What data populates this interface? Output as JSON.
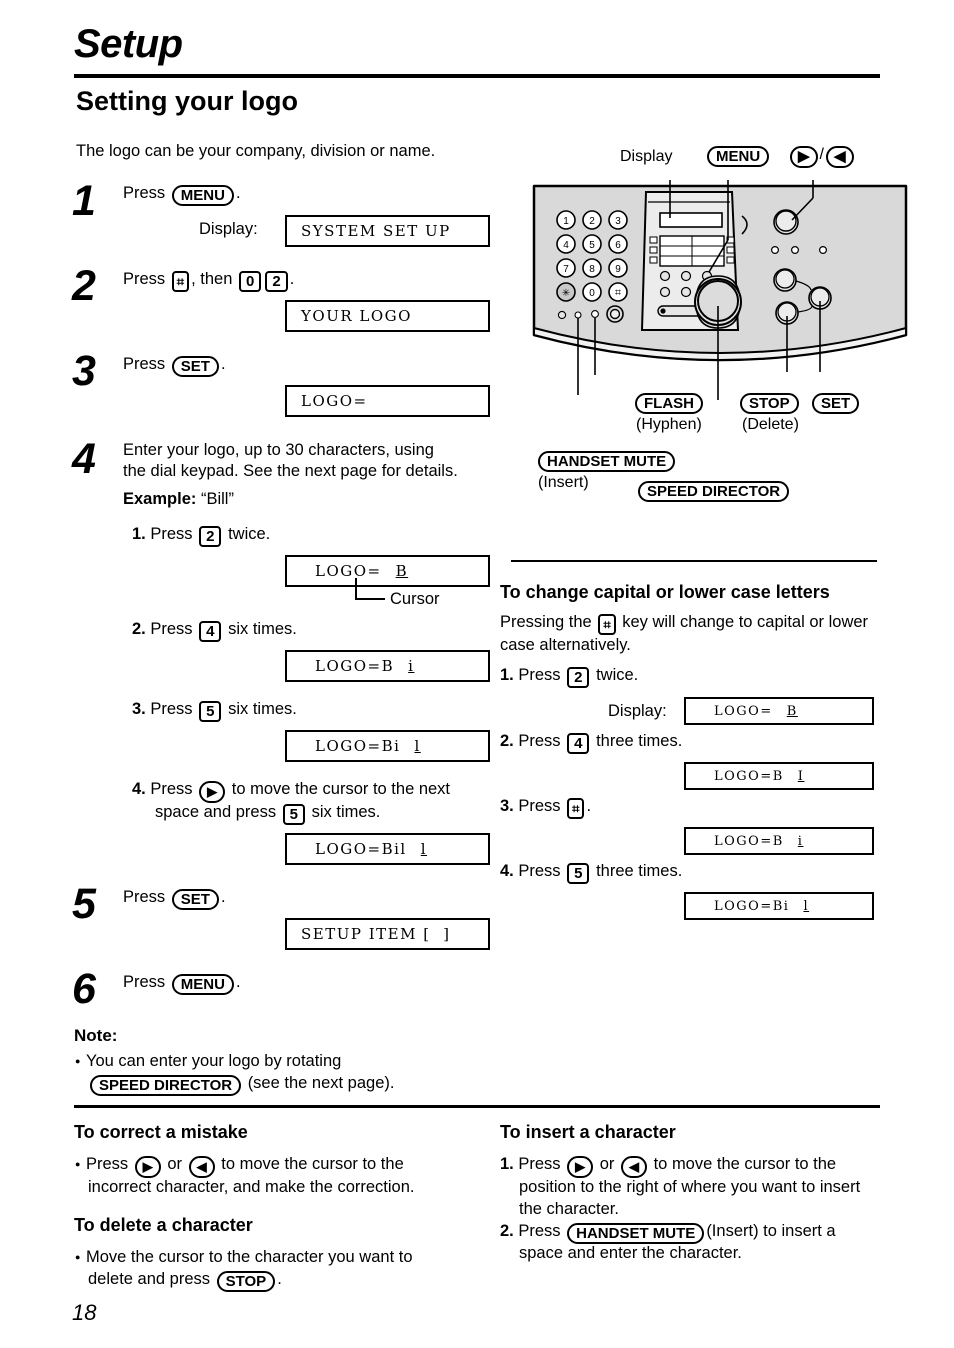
{
  "header": {
    "chapter": "Setup",
    "section": "Setting your logo",
    "intro": "The logo can be your company, division or name."
  },
  "keys": {
    "menu": "MENU",
    "set": "SET",
    "stop": "STOP",
    "flash": "FLASH",
    "handset_mute": "HANDSET MUTE",
    "speed_director": "SPEED DIRECTOR",
    "hash": "⌗",
    "right_arrow": "▶",
    "left_arrow": "◀",
    "d0": "0",
    "d2": "2",
    "d4": "4",
    "d5": "5"
  },
  "steps": [
    {
      "num": "1",
      "text_before": "Press",
      "key": "MENU",
      "text_after": ".",
      "display_label": "Display:",
      "lcd": "SYSTEM SET UP"
    },
    {
      "num": "2",
      "text_before": "Press",
      "text_mid": ", then",
      "text_after": ".",
      "lcd": "YOUR LOGO"
    },
    {
      "num": "3",
      "text_before": "Press",
      "key": "SET",
      "text_after": ".",
      "lcd": "LOGO="
    },
    {
      "num": "4",
      "line1": "Enter your logo, up to 30 characters, using",
      "line2": "the dial keypad. See the next page for details.",
      "example_label": "Example:",
      "example_value": "“Bill”",
      "substeps": [
        {
          "n": "1.",
          "before": "Press",
          "key": "2",
          "after": "twice.",
          "lcd_pre": "LOGO=",
          "lcd_cursor": "B",
          "cursor_label": "Cursor"
        },
        {
          "n": "2.",
          "before": "Press",
          "key": "4",
          "after": "six times.",
          "lcd_pre": "LOGO=B",
          "lcd_cursor": "i"
        },
        {
          "n": "3.",
          "before": "Press",
          "key": "5",
          "after": "six times.",
          "lcd_pre": "LOGO=Bi",
          "lcd_cursor": "l"
        },
        {
          "n": "4.",
          "before": "Press",
          "key": "▶",
          "after_l1": "to move the cursor to the next",
          "after_l2a": "space and press",
          "key2": "5",
          "after_l2b": "six times.",
          "lcd_pre": "LOGO=Bil",
          "lcd_cursor": "l"
        }
      ]
    },
    {
      "num": "5",
      "text_before": "Press",
      "key": "SET",
      "text_after": ".",
      "lcd": "SETUP ITEM [  ]"
    },
    {
      "num": "6",
      "text_before": "Press",
      "key": "MENU",
      "text_after": "."
    }
  ],
  "note": {
    "title": "Note:",
    "line1": "You can enter your logo by rotating",
    "key": "SPEED DIRECTOR",
    "line2": "(see the next page)."
  },
  "device": {
    "label_display": "Display",
    "label_menu": "MENU",
    "label_arrows_slash": "/",
    "label_flash": "FLASH",
    "label_flash_sub": "(Hyphen)",
    "label_stop": "STOP",
    "label_stop_sub": "(Delete)",
    "label_set": "SET",
    "label_handset_mute": "HANDSET MUTE",
    "label_handset_mute_sub": "(Insert)",
    "label_speed_director": "SPEED DIRECTOR",
    "keypad": [
      "1",
      "2",
      "3",
      "4",
      "5",
      "6",
      "7",
      "8",
      "9",
      "✱",
      "0",
      "⌗"
    ],
    "body_color": "#d9d9d9"
  },
  "case_section": {
    "title": "To change capital or lower case letters",
    "intro_a": "Pressing the",
    "intro_b": "key will change to capital or",
    "intro_c": "lower case alternatively.",
    "substeps": [
      {
        "n": "1.",
        "before": "Press",
        "key": "2",
        "after": "twice.",
        "display_label": "Display:",
        "lcd_pre": "LOGO=",
        "lcd_cursor": "B"
      },
      {
        "n": "2.",
        "before": "Press",
        "key": "4",
        "after": "three times.",
        "lcd_pre": "LOGO=B",
        "lcd_cursor": "I"
      },
      {
        "n": "3.",
        "before": "Press",
        "key": "⌗",
        "after": ".",
        "lcd_pre": "LOGO=B",
        "lcd_cursor": "i"
      },
      {
        "n": "4.",
        "before": "Press",
        "key": "5",
        "after": "three times.",
        "lcd_pre": "LOGO=Bi",
        "lcd_cursor": "l"
      }
    ]
  },
  "correct_section": {
    "title": "To correct a mistake",
    "line1a": "Press",
    "line1b": "or",
    "line1c": "to move the cursor to the",
    "line2": "incorrect character, and make the correction."
  },
  "delete_section": {
    "title": "To delete a character",
    "line1": "Move the cursor to the character you want to",
    "line2a": "delete and press",
    "key": "STOP",
    "line2b": "."
  },
  "insert_section": {
    "title": "To insert a character",
    "s1_n": "1.",
    "s1_a": "Press",
    "s1_b": "or",
    "s1_c": "to move the cursor to the",
    "s1_d": "position to the right of where you want to insert",
    "s1_e": "the character.",
    "s2_n": "2.",
    "s2_a": "Press",
    "s2_key": "HANDSET MUTE",
    "s2_b": "(Insert) to insert a",
    "s2_c": "space and enter the character."
  },
  "page_number": "18"
}
